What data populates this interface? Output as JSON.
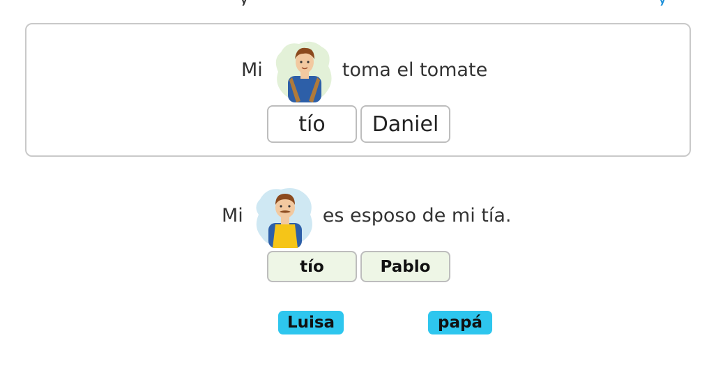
{
  "instruction": {
    "text_visible": "y",
    "link_visible": "y"
  },
  "question1": {
    "before": "Mi",
    "image_icon": "man-vest-avatar-icon",
    "after": "toma el tomate",
    "choices": [
      "tío",
      "Daniel"
    ]
  },
  "question2": {
    "before": "Mi",
    "image_icon": "man-mustache-apron-avatar-icon",
    "after": "es esposo de mi tía.",
    "choices": [
      "tío",
      "Pablo"
    ]
  },
  "word_bank": [
    "Luisa",
    "papá"
  ],
  "colors": {
    "chip": "#2ec6ee",
    "answered_bg": "#eef6e6",
    "border": "#bdbdbd",
    "link": "#1b8fd9"
  }
}
